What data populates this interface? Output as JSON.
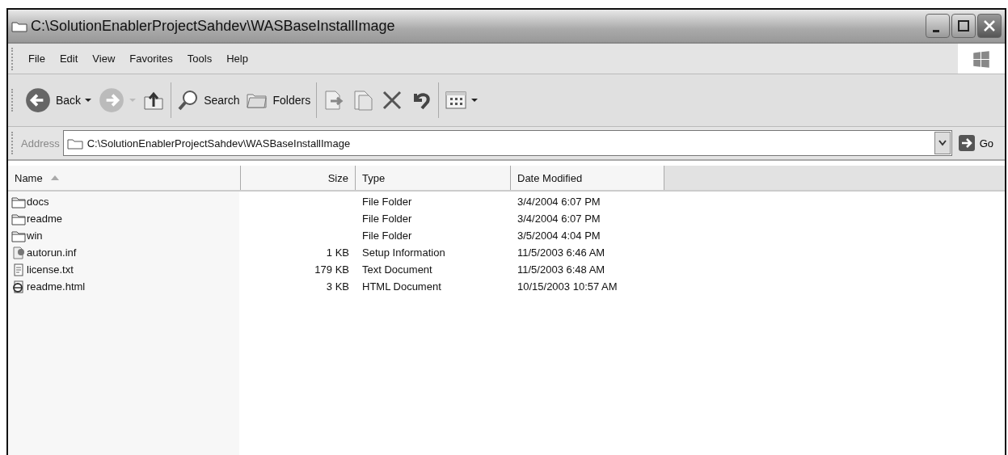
{
  "window": {
    "title": "C:\\SolutionEnablerProjectSahdev\\WASBaseInstallImage"
  },
  "menu": [
    "File",
    "Edit",
    "View",
    "Favorites",
    "Tools",
    "Help"
  ],
  "toolbar": [
    {
      "kind": "back",
      "label": "Back",
      "disabled": false
    },
    {
      "kind": "forward",
      "disabled": true
    },
    {
      "kind": "up"
    },
    {
      "kind": "separator"
    },
    {
      "kind": "search",
      "label": "Search"
    },
    {
      "kind": "folders",
      "label": "Folders"
    },
    {
      "kind": "separator"
    },
    {
      "kind": "move"
    },
    {
      "kind": "copy"
    },
    {
      "kind": "delete"
    },
    {
      "kind": "undo"
    },
    {
      "kind": "separator"
    },
    {
      "kind": "views"
    }
  ],
  "address": {
    "label": "Address",
    "value": "C:\\SolutionEnablerProjectSahdev\\WASBaseInstallImage",
    "go": "Go"
  },
  "columns": [
    {
      "label": "Name",
      "sorted": true
    },
    {
      "label": "Size",
      "sorted": false
    },
    {
      "label": "Type",
      "sorted": false
    },
    {
      "label": "Date Modified",
      "sorted": false
    }
  ],
  "rows": [
    {
      "kind": "folder",
      "name": "docs",
      "type": "File Folder",
      "date": "3/4/2004 6:07 PM"
    },
    {
      "kind": "folder",
      "name": "readme",
      "type": "File Folder",
      "date": "3/4/2004 6:07 PM"
    },
    {
      "kind": "folder",
      "name": "win",
      "type": "File Folder",
      "date": "3/5/2004 4:04 PM"
    },
    {
      "kind": "setup",
      "name": "autorun.inf",
      "size": "1 KB",
      "type": "Setup Information",
      "date": "11/5/2003 6:46 AM"
    },
    {
      "kind": "text",
      "name": "license.txt",
      "size": "179 KB",
      "type": "Text Document",
      "date": "11/5/2003 6:48 AM"
    },
    {
      "kind": "html",
      "name": "readme.html",
      "size": "3 KB",
      "type": "HTML Document",
      "date": "10/15/2003 10:57 AM"
    }
  ]
}
